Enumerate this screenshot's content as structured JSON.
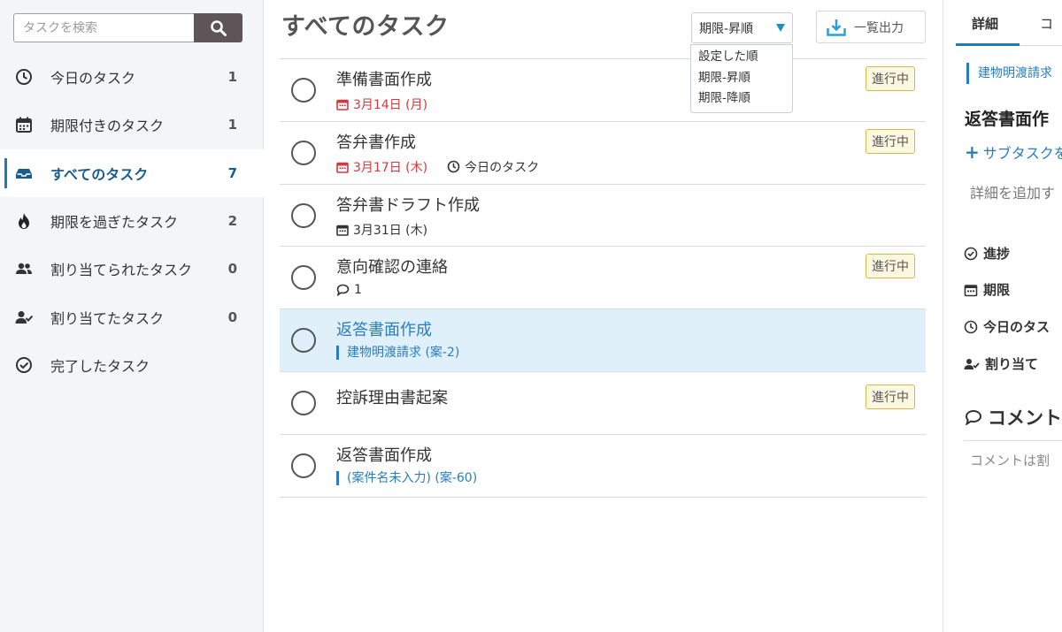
{
  "search": {
    "placeholder": "タスクを検索"
  },
  "sidebar": {
    "items": [
      {
        "label": "今日のタスク",
        "count": "1",
        "icon": "clock-icon"
      },
      {
        "label": "期限付きのタスク",
        "count": "1",
        "icon": "calendar-icon"
      },
      {
        "label": "すべてのタスク",
        "count": "7",
        "icon": "inbox-icon",
        "active": true
      },
      {
        "label": "期限を過ぎたタスク",
        "count": "2",
        "icon": "fire-icon"
      },
      {
        "label": "割り当てられたタスク",
        "count": "0",
        "icon": "users-icon"
      },
      {
        "label": "割り当てたタスク",
        "count": "0",
        "icon": "user-check-icon"
      },
      {
        "label": "完了したタスク",
        "count": "",
        "icon": "check-circle-icon"
      }
    ]
  },
  "main": {
    "title": "すべてのタスク",
    "sort": {
      "selected": "期限-昇順",
      "options": [
        "設定した順",
        "期限-昇順",
        "期限-降順"
      ]
    },
    "export_label": "一覧出力",
    "tasks": [
      {
        "name": "準備書面作成",
        "due": "3月14日 (月)",
        "badge": "進行中"
      },
      {
        "name": "答弁書作成",
        "due": "3月17日 (木)",
        "today": "今日のタスク",
        "badge": "進行中"
      },
      {
        "name": "答弁書ドラフト作成",
        "due": "3月31日 (木)"
      },
      {
        "name": "意向確認の連絡",
        "comments": "1",
        "badge": "進行中"
      },
      {
        "name": "返答書面作成",
        "project": "建物明渡請求 (案-2)"
      },
      {
        "name": "控訴理由書起案",
        "badge": "進行中"
      },
      {
        "name": "返答書面作成",
        "project": "(案件名未入力) (案-60)"
      }
    ]
  },
  "detail": {
    "tabs": [
      "詳細",
      "コ"
    ],
    "project": "建物明渡請求",
    "title": "返答書面作",
    "add_subtask": "サブタスクを",
    "description_placeholder": "詳細を追加す",
    "fields": [
      "進捗",
      "期限",
      "今日のタス",
      "割り当て"
    ],
    "comment_heading": "コメント",
    "comment_placeholder": "コメントは割"
  },
  "colors": {
    "accent": "#1f7bbf",
    "overdue": "#d0393e",
    "badge_border": "#d7b84a",
    "selected_row": "#dff0fa"
  }
}
